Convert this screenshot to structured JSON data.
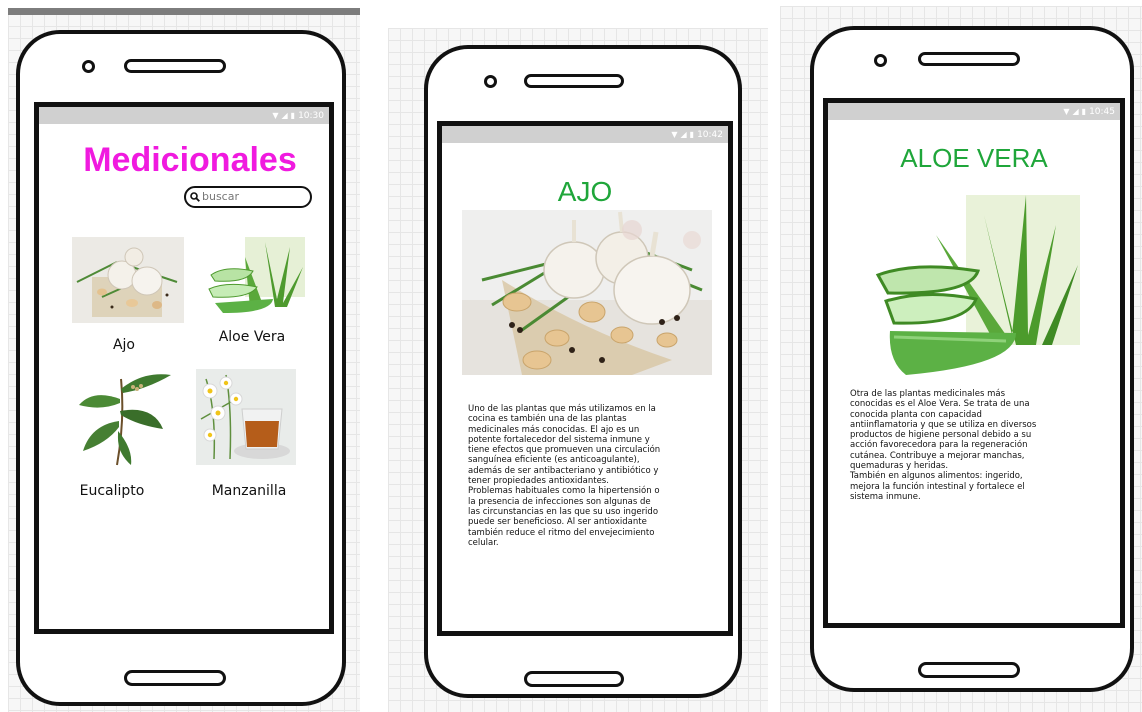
{
  "screens": {
    "list": {
      "status_time": "10:30",
      "title": "Medicionales",
      "search": {
        "placeholder": "buscar"
      },
      "plants": [
        {
          "label": "Ajo"
        },
        {
          "label": "Aloe Vera"
        },
        {
          "label": "Eucalipto"
        },
        {
          "label": "Manzanilla"
        }
      ]
    },
    "ajo": {
      "status_time": "10:42",
      "title": "AJO",
      "description": "Uno de las plantas que más utilizamos en la\ncocina es también una de las plantas\nmedicinales más conocidas. El ajo es un\npotente fortalecedor del sistema inmune y\ntiene efectos que promueven una circulación\nsanguínea eficiente (es anticoagulante),\nademás de ser antibacteriano y antibiótico y\ntener propiedades antioxidantes.\nProblemas habituales como la hipertensión o\nla presencia de infecciones son algunas de\nlas circunstancias en las que su uso ingerido\npuede ser beneficioso. Al ser antioxidante\ntambién reduce el ritmo del envejecimiento\ncelular."
    },
    "aloe": {
      "status_time": "10:45",
      "title": "ALOE VERA",
      "description": "Otra de las plantas medicinales más\nconocidas es el Aloe Vera. Se trata de una\nconocida planta con capacidad\nantiinflamatoria y que se utiliza en diversos\nproductos de higiene personal debido a su\nacción favorecedora para la regeneración\ncutánea. Contribuye a mejorar manchas,\nquemaduras y heridas.\nTambién en algunos alimentos: ingerido,\nmejora la función intestinal y fortalece el\nsistema inmune."
    }
  },
  "icons": {
    "status": [
      "wifi-icon",
      "signal-icon",
      "battery-icon"
    ],
    "search": "search-icon"
  },
  "colors": {
    "title_magenta": "#f01adf",
    "title_green": "#1fa63a",
    "status_bar": "#d0d0d0",
    "frame": "#111111"
  }
}
